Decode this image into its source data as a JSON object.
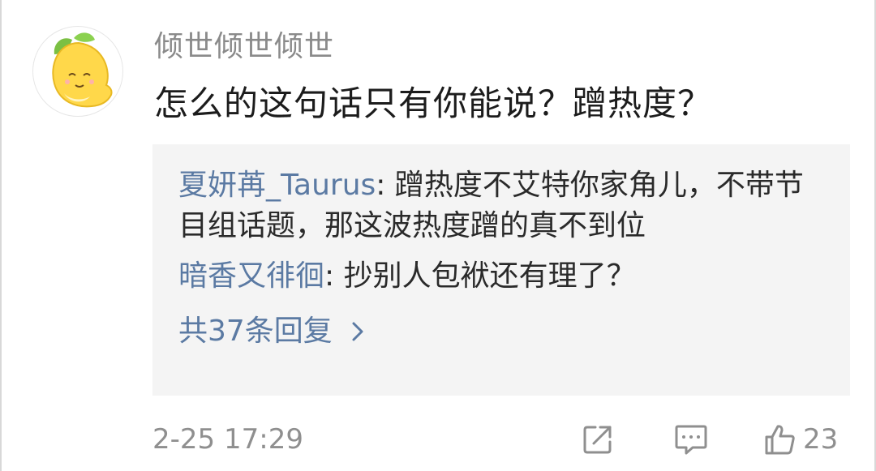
{
  "comment": {
    "username": "倾世倾世倾世",
    "text": "怎么的这句话只有你能说？蹭热度？",
    "timestamp": "2-25 17:29",
    "like_count": "23",
    "avatar_icon": "lemon-character-icon"
  },
  "replies": [
    {
      "name": "夏妍苒_Taurus",
      "separator": ": ",
      "text": "蹭热度不艾特你家角儿，不带节目组话题，那这波热度蹭的真不到位"
    },
    {
      "name": "暗香又徘徊",
      "separator": ": ",
      "text": "抄别人包袱还有理了？"
    }
  ],
  "more_replies_label": "共37条回复",
  "icons": {
    "share": "share-icon",
    "comment": "comment-icon",
    "like": "thumbs-up-icon",
    "chevron": "chevron-right-icon"
  },
  "colors": {
    "link": "#5b7aa3",
    "muted": "#8f8f8f",
    "text": "#1c1c1c",
    "reply_bg": "#f4f4f4"
  }
}
